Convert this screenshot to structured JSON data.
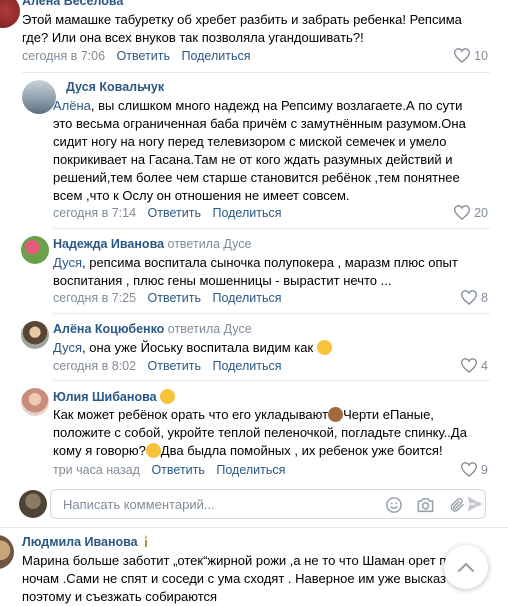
{
  "comments": [
    {
      "author": "Алена Веселова",
      "text": "Этой мамашке табуретку об хребет разбить и забрать ребенка! Репсима где? Или она всех внуков так позволяла угандошивать?!",
      "time": "сегодня в 7:06",
      "reply_label": "Ответить",
      "share_label": "Поделиться",
      "likes": "10"
    },
    {
      "author": "Дуся Ковальчук",
      "mention": "Алёна",
      "text": ", вы слишком много надежд на Репсиму возлагаете.А по сути это весьма ограниченная баба причём с замутнённым разумом.Она сидит ногу на ногу перед телевизором с миской семечек и умело покрикивает на Гасана.Там не от кого ждать разумных действий и решений,тем более чем старше становится ребёнок ,тем понятнее всем ,что к Ослу он отношения не имеет совсем.",
      "time": "сегодня в 7:14",
      "reply_label": "Ответить",
      "share_label": "Поделиться",
      "likes": "20"
    },
    {
      "author": "Надежда Иванова",
      "replied_to": "ответила Дусе",
      "mention": "Дуся",
      "text": ", репсима воспитала сыночка полупокера , маразм плюс опыт воспитания , плюс гены мошенницы - вырастит нечто ...",
      "time": "сегодня в 7:25",
      "reply_label": "Ответить",
      "share_label": "Поделиться",
      "likes": "8"
    },
    {
      "author": "Алёна Коцюбенко",
      "replied_to": "ответила Дусе",
      "mention": "Дуся",
      "text": ", она уже Йоську воспитала видим как",
      "time": "сегодня в 8:02",
      "reply_label": "Ответить",
      "share_label": "Поделиться",
      "likes": "4"
    },
    {
      "author": "Юлия Шибанова",
      "text_part1": "Как может ребёнок орать что его укладывают",
      "text_part2": "Черти еПаные, положите с собой, укройте теплой пеленочкой, погладьте спинку..Да кому я говорю?",
      "text_part3": "Два быдла помойных , их ребенок уже боится!",
      "time": "три часа назад",
      "reply_label": "Ответить",
      "share_label": "Поделиться",
      "likes": "9"
    },
    {
      "author": "Людмила Иванова",
      "text": "Марина больше заботит „отек“жирной рожи ,а не то что Шаман орет по ночам .Сами не спят и соседи с ума сходят . Наверное им уже высказ поэтому и съезжать собираются"
    }
  ],
  "comment_input": {
    "placeholder": "Написать комментарий..."
  },
  "icons": {
    "like": "heart-outline-icon",
    "emoji": "smile-icon",
    "camera": "camera-icon",
    "attach": "paperclip-icon",
    "send": "send-icon",
    "scroll_up": "chevron-up-icon"
  },
  "colors": {
    "link": "#2a5885",
    "meta": "#818c99",
    "separator": "#e7e8ec"
  }
}
